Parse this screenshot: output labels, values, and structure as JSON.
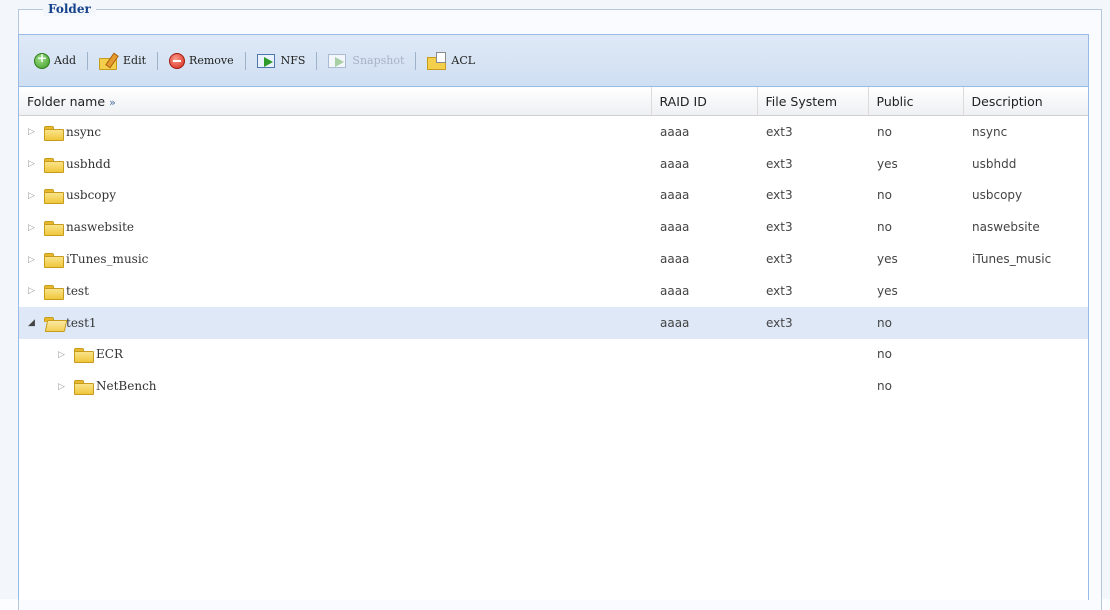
{
  "panel": {
    "title": "Folder"
  },
  "toolbar": {
    "add": "Add",
    "edit": "Edit",
    "remove": "Remove",
    "nfs": "NFS",
    "snapshot": "Snapshot",
    "acl": "ACL"
  },
  "columns": {
    "name": "Folder name",
    "name_arrow": "»",
    "raid": "RAID ID",
    "fs": "File System",
    "public": "Public",
    "desc": "Description"
  },
  "rows": [
    {
      "name": "nsync",
      "raid": "aaaa",
      "fs": "ext3",
      "public": "no",
      "desc": "nsync"
    },
    {
      "name": "usbhdd",
      "raid": "aaaa",
      "fs": "ext3",
      "public": "yes",
      "desc": "usbhdd"
    },
    {
      "name": "usbcopy",
      "raid": "aaaa",
      "fs": "ext3",
      "public": "no",
      "desc": "usbcopy"
    },
    {
      "name": "naswebsite",
      "raid": "aaaa",
      "fs": "ext3",
      "public": "no",
      "desc": "naswebsite"
    },
    {
      "name": "iTunes_music",
      "raid": "aaaa",
      "fs": "ext3",
      "public": "yes",
      "desc": "iTunes_music"
    },
    {
      "name": "test",
      "raid": "aaaa",
      "fs": "ext3",
      "public": "yes",
      "desc": ""
    },
    {
      "name": "test1",
      "raid": "aaaa",
      "fs": "ext3",
      "public": "no",
      "desc": ""
    },
    {
      "name": "ECR",
      "raid": "",
      "fs": "",
      "public": "no",
      "desc": ""
    },
    {
      "name": "NetBench",
      "raid": "",
      "fs": "",
      "public": "no",
      "desc": ""
    }
  ]
}
